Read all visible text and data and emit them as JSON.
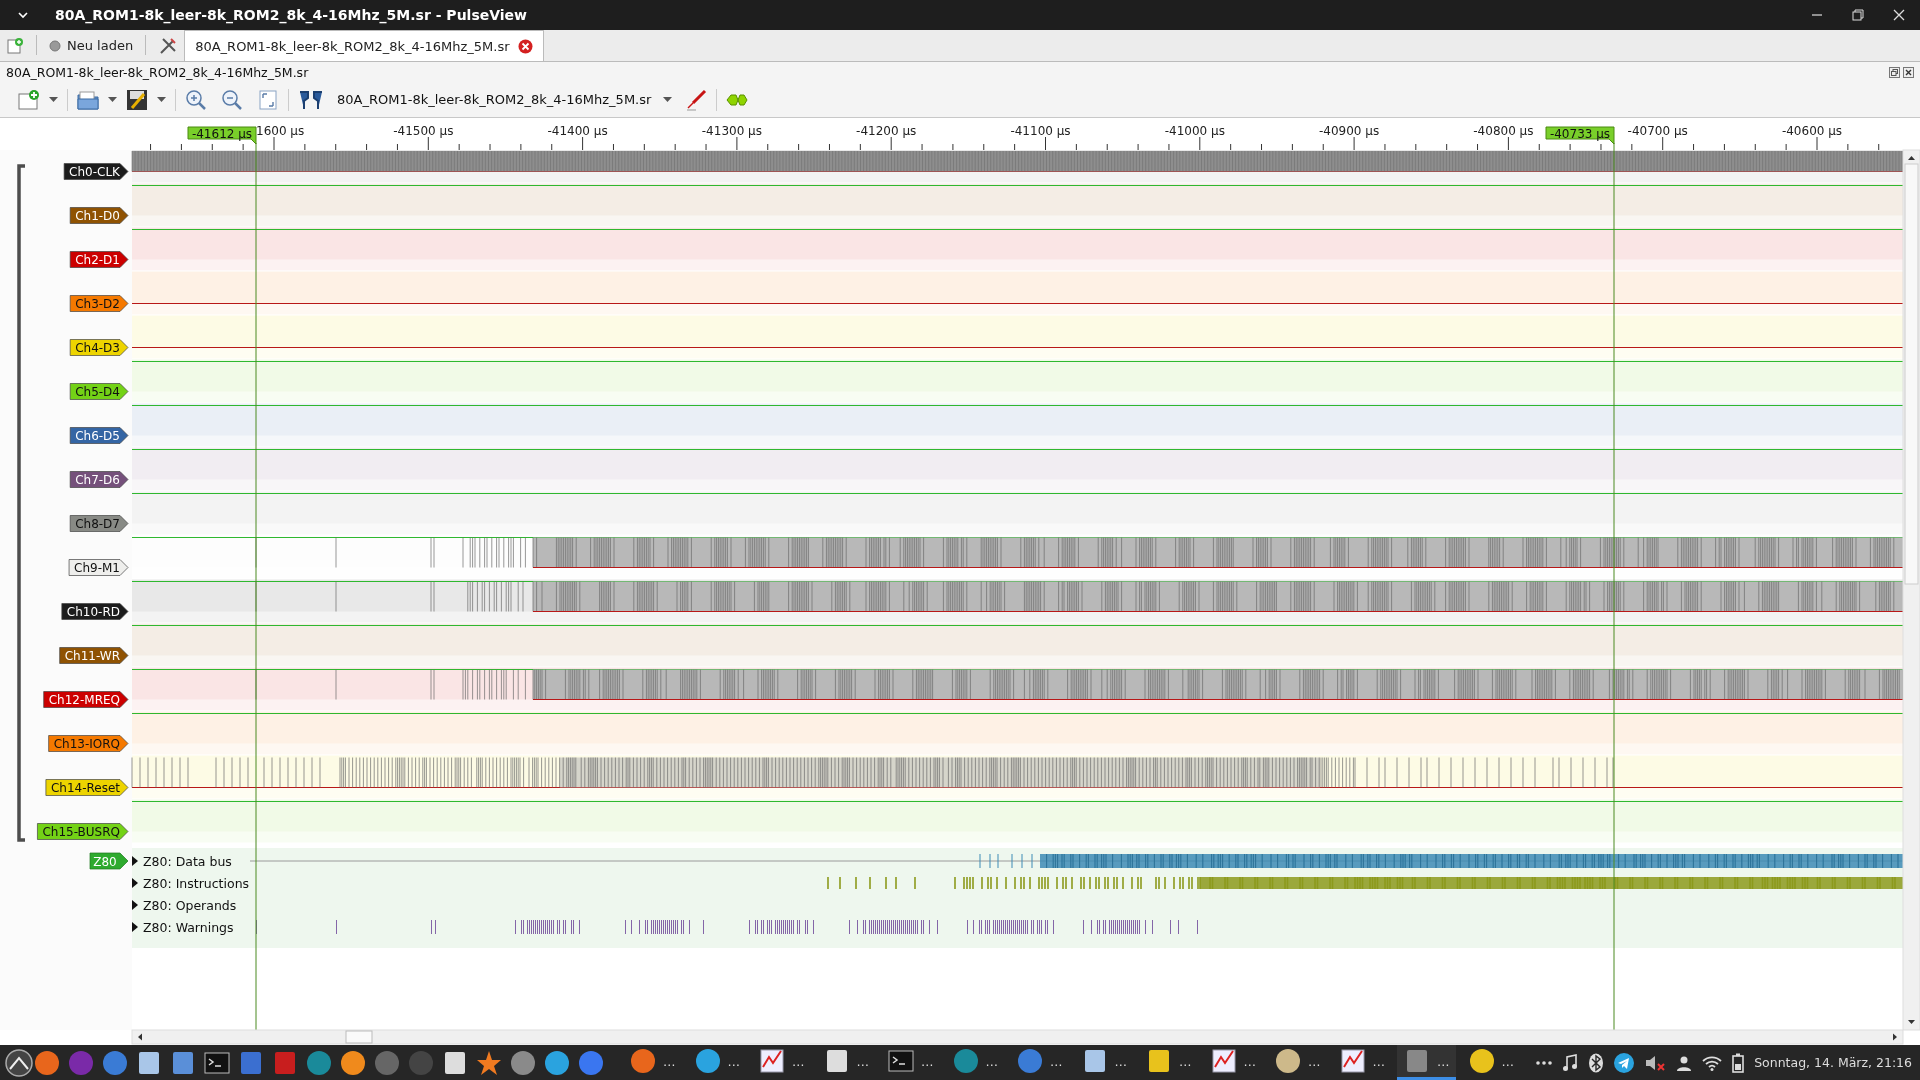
{
  "window": {
    "title": "80A_ROM1-8k_leer-8k_ROM2_8k_4-16Mhz_5M.sr - PulseView"
  },
  "tab_bar": {
    "reload_button": "Neu laden",
    "tabs": [
      {
        "label": "80A_ROM1-8k_leer-8k_ROM2_8k_4-16Mhz_5M.sr",
        "selected": true
      }
    ]
  },
  "session": {
    "title": "80A_ROM1-8k_leer-8k_ROM2_8k_4-16Mhz_5M.sr"
  },
  "toolbar": {
    "device": "80A_ROM1-8k_leer-8k_ROM2_8k_4-16Mhz_5M.sr"
  },
  "ruler": {
    "labels": [
      "1600 µs",
      "-41500 µs",
      "-41400 µs",
      "-41300 µs",
      "-41200 µs",
      "-41100 µs",
      "-41000 µs",
      "-40900 µs",
      "-40800 µs",
      "-40700 µs",
      "-40600 µs"
    ]
  },
  "cursors": [
    {
      "label": "-41612 µs"
    },
    {
      "label": "-40733 µs"
    }
  ],
  "channels": [
    {
      "name": "Ch0-CLK",
      "color": "#1c1c1c",
      "high": false,
      "kind": "clock"
    },
    {
      "name": "Ch1-D0",
      "color": "#8f5202",
      "high": true,
      "kind": "flat"
    },
    {
      "name": "Ch2-D1",
      "color": "#cc0000",
      "high": true,
      "kind": "flat"
    },
    {
      "name": "Ch3-D2",
      "color": "#f57900",
      "high": false,
      "kind": "flat"
    },
    {
      "name": "Ch4-D3",
      "color": "#edd400",
      "high": false,
      "kind": "flat"
    },
    {
      "name": "Ch5-D4",
      "color": "#73d216",
      "high": true,
      "kind": "flat"
    },
    {
      "name": "Ch6-D5",
      "color": "#3465a4",
      "high": true,
      "kind": "flat"
    },
    {
      "name": "Ch7-D6",
      "color": "#75507b",
      "high": true,
      "kind": "flat"
    },
    {
      "name": "Ch8-D7",
      "color": "#888a85",
      "high": true,
      "kind": "flat"
    },
    {
      "name": "Ch9-M1",
      "color": "#eeeeec",
      "high": true,
      "kind": "bus"
    },
    {
      "name": "Ch10-RD",
      "color": "#1c1c1c",
      "high": true,
      "kind": "bus"
    },
    {
      "name": "Ch11-WR",
      "color": "#8f5202",
      "high": true,
      "kind": "flat"
    },
    {
      "name": "Ch12-MREQ",
      "color": "#cc0000",
      "high": true,
      "kind": "bus"
    },
    {
      "name": "Ch13-IORQ",
      "color": "#f57900",
      "high": true,
      "kind": "flat"
    },
    {
      "name": "Ch14-Reset",
      "color": "#edd400",
      "high": false,
      "kind": "pulses"
    },
    {
      "name": "Ch15-BUSRQ",
      "color": "#73d216",
      "high": true,
      "kind": "flat"
    }
  ],
  "decoder": {
    "name": "Z80",
    "color": "#2eaa2e",
    "rows": [
      {
        "title": "Z80: Data bus",
        "expanded": false,
        "kind": "bus",
        "color": "#3d8bb5"
      },
      {
        "title": "Z80: Instructions",
        "expanded": false,
        "kind": "instructions",
        "color": "#8c9a1c"
      },
      {
        "title": "Z80: Operands",
        "expanded": false,
        "kind": "empty"
      },
      {
        "title": "Z80: Warnings",
        "expanded": false,
        "kind": "warnings",
        "color": "#8466a8"
      }
    ]
  },
  "taskbar": {
    "tasks": [
      {
        "label": "…",
        "selected": false
      },
      {
        "label": "…",
        "selected": false
      },
      {
        "label": "…",
        "selected": false
      },
      {
        "label": "…",
        "selected": false
      },
      {
        "label": "…",
        "selected": false
      },
      {
        "label": "…",
        "selected": false
      },
      {
        "label": "…",
        "selected": false
      },
      {
        "label": "…",
        "selected": false
      },
      {
        "label": "…",
        "selected": false
      },
      {
        "label": "…",
        "selected": false
      },
      {
        "label": "…",
        "selected": false
      },
      {
        "label": "…",
        "selected": false
      },
      {
        "label": "…",
        "selected": true
      },
      {
        "label": "…",
        "selected": false
      }
    ],
    "clock": "Sonntag, 14. März, 21:16"
  }
}
